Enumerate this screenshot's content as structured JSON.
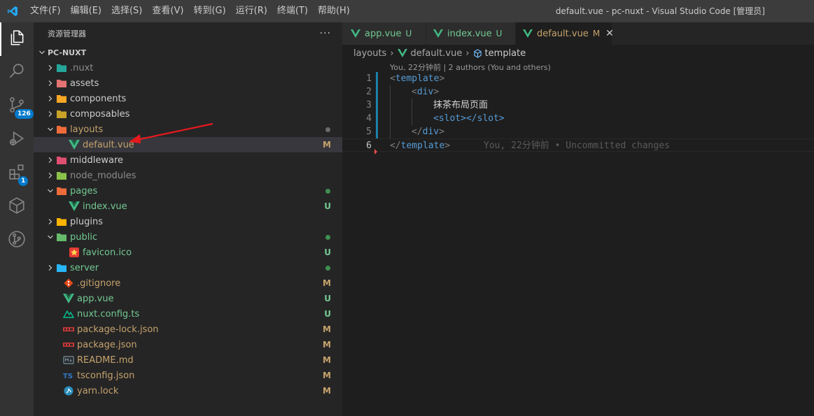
{
  "titlebar": {
    "menus": [
      "文件(F)",
      "编辑(E)",
      "选择(S)",
      "查看(V)",
      "转到(G)",
      "运行(R)",
      "终端(T)",
      "帮助(H)"
    ],
    "window_title": "default.vue - pc-nuxt - Visual Studio Code [管理员]"
  },
  "activitybar": {
    "items": [
      {
        "icon": "files-icon",
        "active": true
      },
      {
        "icon": "search-icon"
      },
      {
        "icon": "source-control-icon",
        "badge": "126"
      },
      {
        "icon": "run-debug-icon"
      },
      {
        "icon": "extensions-icon",
        "badge": "1"
      },
      {
        "icon": "remote-explorer-icon"
      },
      {
        "icon": "git-graph-icon"
      }
    ]
  },
  "sidebar": {
    "title": "资源管理器",
    "more": "···",
    "project": "PC-NUXT",
    "tree": [
      {
        "name": ".nuxt",
        "type": "folder",
        "open": false,
        "indent": 0,
        "color": "#8c8c8c",
        "icon_color": "#26a69a"
      },
      {
        "name": "assets",
        "type": "folder",
        "open": false,
        "indent": 0,
        "color": "#cccccc",
        "icon_color": "#e57373"
      },
      {
        "name": "components",
        "type": "folder",
        "open": false,
        "indent": 0,
        "color": "#cccccc",
        "icon_color": "#f9a825"
      },
      {
        "name": "composables",
        "type": "folder",
        "open": false,
        "indent": 0,
        "color": "#cccccc",
        "icon_color": "#c9a227"
      },
      {
        "name": "layouts",
        "type": "folder",
        "open": true,
        "indent": 0,
        "color": "#c5a26b",
        "icon_color": "#ef6c3a",
        "dot": "#6b6b6b"
      },
      {
        "name": "default.vue",
        "type": "vue",
        "indent": 1,
        "color": "#c5a26b",
        "status": "M",
        "status_color": "#c5a26b",
        "selected": true
      },
      {
        "name": "middleware",
        "type": "folder",
        "open": false,
        "indent": 0,
        "color": "#cccccc",
        "icon_color": "#e04f6f"
      },
      {
        "name": "node_modules",
        "type": "folder",
        "open": false,
        "indent": 0,
        "color": "#8c8c8c",
        "icon_color": "#8bc34a"
      },
      {
        "name": "pages",
        "type": "folder",
        "open": true,
        "indent": 0,
        "color": "#73c991",
        "icon_color": "#ef6c3a",
        "dot": "#3f8f52"
      },
      {
        "name": "index.vue",
        "type": "vue",
        "indent": 1,
        "color": "#73c991",
        "status": "U",
        "status_color": "#73c991"
      },
      {
        "name": "plugins",
        "type": "folder",
        "open": false,
        "indent": 0,
        "color": "#cccccc",
        "icon_color": "#ffb300"
      },
      {
        "name": "public",
        "type": "folder",
        "open": true,
        "indent": 0,
        "color": "#73c991",
        "icon_color": "#66bb6a",
        "dot": "#3f8f52"
      },
      {
        "name": "favicon.ico",
        "type": "star",
        "indent": 1,
        "color": "#73c991",
        "status": "U",
        "status_color": "#73c991"
      },
      {
        "name": "server",
        "type": "folder",
        "open": false,
        "indent": 0,
        "color": "#73c991",
        "icon_color": "#29b6f6",
        "dot": "#3f8f52"
      },
      {
        "name": ".gitignore",
        "type": "git",
        "indent": 0,
        "color": "#c5a26b",
        "status": "M",
        "status_color": "#c5a26b"
      },
      {
        "name": "app.vue",
        "type": "vue",
        "indent": 0,
        "color": "#73c991",
        "status": "U",
        "status_color": "#73c991"
      },
      {
        "name": "nuxt.config.ts",
        "type": "nuxt",
        "indent": 0,
        "color": "#73c991",
        "status": "U",
        "status_color": "#73c991"
      },
      {
        "name": "package-lock.json",
        "type": "npm",
        "indent": 0,
        "color": "#c5a26b",
        "status": "M",
        "status_color": "#c5a26b"
      },
      {
        "name": "package.json",
        "type": "npm",
        "indent": 0,
        "color": "#c5a26b",
        "status": "M",
        "status_color": "#c5a26b"
      },
      {
        "name": "README.md",
        "type": "md",
        "indent": 0,
        "color": "#c5a26b",
        "status": "M",
        "status_color": "#c5a26b"
      },
      {
        "name": "tsconfig.json",
        "type": "ts",
        "indent": 0,
        "color": "#c5a26b",
        "status": "M",
        "status_color": "#c5a26b"
      },
      {
        "name": "yarn.lock",
        "type": "yarn",
        "indent": 0,
        "color": "#c5a26b",
        "status": "M",
        "status_color": "#c5a26b"
      }
    ]
  },
  "tabs": [
    {
      "label": "app.vue",
      "status": "U",
      "color": "#73c991",
      "active": false
    },
    {
      "label": "index.vue",
      "status": "U",
      "color": "#73c991",
      "active": false
    },
    {
      "label": "default.vue",
      "status": "M",
      "color": "#c5a26b",
      "active": true,
      "close": "✕"
    }
  ],
  "breadcrumb": {
    "folder": "layouts",
    "file": "default.vue",
    "symbol": "template"
  },
  "codelens": "You, 22分钟前 | 2 authors (You and others)",
  "code": {
    "lines": [
      {
        "n": "1",
        "open": "<",
        "tag": "template",
        "close": ">",
        "indent": 0
      },
      {
        "n": "2",
        "open": "<",
        "tag": "div",
        "close": ">",
        "indent": 1
      },
      {
        "n": "3",
        "text": "抹茶布局页面",
        "indent": 2
      },
      {
        "n": "4",
        "slot_open": "<slot>",
        "slot_close": "</slot>",
        "indent": 2
      },
      {
        "n": "5",
        "open": "</",
        "tag": "div",
        "close": ">",
        "indent": 1
      },
      {
        "n": "6",
        "open": "</",
        "tag": "template",
        "close": ">",
        "indent": 0,
        "blame": "You, 22分钟前 • Uncommitted changes"
      }
    ]
  }
}
